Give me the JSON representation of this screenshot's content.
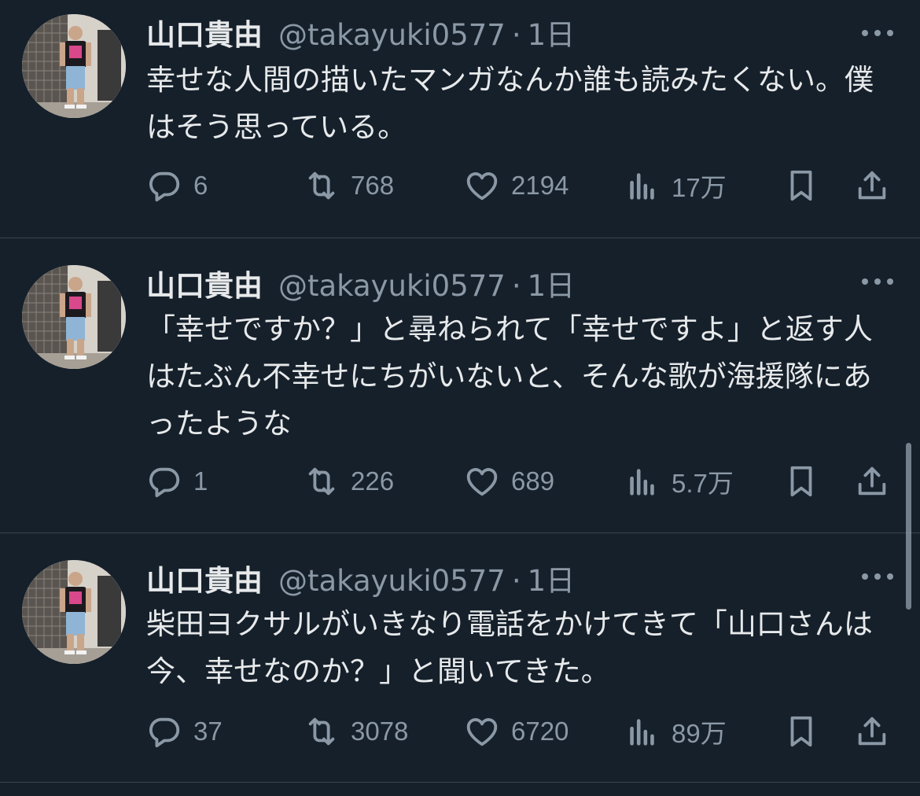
{
  "colors": {
    "background": "#15202b",
    "text": "#e7e9ea",
    "muted": "#8b98a5",
    "divider": "#38444d"
  },
  "tweets": [
    {
      "name": "山口貴由",
      "handle": "@takayuki0577",
      "dot": "·",
      "time": "1日",
      "text": "幸せな人間の描いたマンガなんか誰も読みたくない。僕はそう思っている。",
      "replies": "6",
      "retweets": "768",
      "likes": "2194",
      "views": "17万"
    },
    {
      "name": "山口貴由",
      "handle": "@takayuki0577",
      "dot": "·",
      "time": "1日",
      "text": "「幸せですか？」と尋ねられて「幸せですよ」と返す人はたぶん不幸せにちがいないと、そんな歌が海援隊にあったような",
      "replies": "1",
      "retweets": "226",
      "likes": "689",
      "views": "5.7万"
    },
    {
      "name": "山口貴由",
      "handle": "@takayuki0577",
      "dot": "·",
      "time": "1日",
      "text": "柴田ヨクサルがいきなり電話をかけてきて「山口さんは今、幸せなのか？」と聞いてきた。",
      "replies": "37",
      "retweets": "3078",
      "likes": "6720",
      "views": "89万"
    }
  ],
  "icons": [
    "more-icon",
    "reply-icon",
    "retweet-icon",
    "like-icon",
    "views-icon",
    "bookmark-icon",
    "share-icon"
  ]
}
